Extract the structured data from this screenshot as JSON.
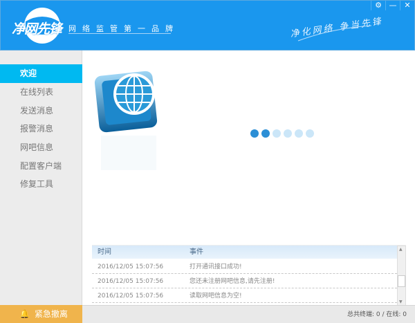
{
  "header": {
    "logo_text": "净网先锋",
    "slogan": "网络监管第一品牌",
    "motto": "净化网络 争当先锋",
    "window_buttons": [
      {
        "icon": "gear-icon",
        "glyph": "⚙"
      },
      {
        "icon": "minimize-icon",
        "glyph": "—"
      },
      {
        "icon": "close-icon",
        "glyph": "✕"
      }
    ]
  },
  "sidebar": {
    "items": [
      {
        "label": "欢迎",
        "active": true
      },
      {
        "label": "在线列表"
      },
      {
        "label": "发送消息"
      },
      {
        "label": "报警消息"
      },
      {
        "label": "网吧信息"
      },
      {
        "label": "配置客户端"
      },
      {
        "label": "修复工具"
      }
    ],
    "emergency": {
      "icon": "bell-icon",
      "label": "紧急撤离"
    }
  },
  "main": {
    "loading_dots": {
      "total": 6,
      "active": 2
    },
    "colors": {
      "dot_active": "#2c8fd6",
      "dot_inactive": "#cbe6f8"
    }
  },
  "log": {
    "columns": [
      "时间",
      "事件"
    ],
    "rows": [
      [
        "2016/12/05 15:07:56",
        "打开通讯接口成功!"
      ],
      [
        "2016/12/05 15:07:56",
        "您还未注册网吧信息,请先注册!"
      ],
      [
        "2016/12/05 15:07:56",
        "读取网吧信息为空!"
      ]
    ]
  },
  "status": {
    "text": "总共终端: 0 / 在线: 0"
  },
  "colors": {
    "header": "#1a97ee",
    "active_nav": "#00b9f1",
    "emergency": "#f0b44c"
  }
}
